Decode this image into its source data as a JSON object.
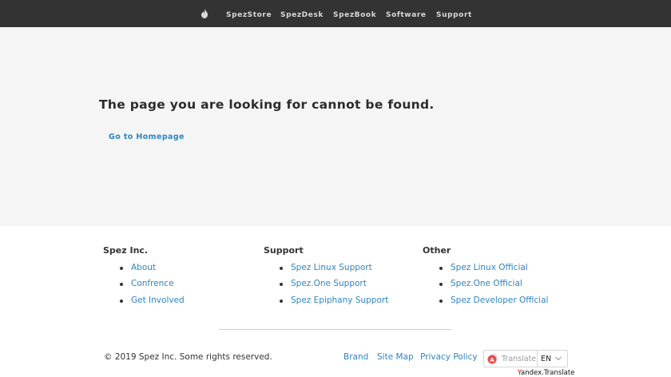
{
  "nav": {
    "logo_icon": "spez-flame-logo-icon",
    "items": [
      {
        "label": "SpezStore"
      },
      {
        "label": "SpezDesk"
      },
      {
        "label": "SpezBook"
      },
      {
        "label": "Software"
      },
      {
        "label": "Support"
      }
    ]
  },
  "main": {
    "headline": "The page you are looking for cannot be found.",
    "home_link": "Go to Homepage"
  },
  "footer": {
    "columns": [
      {
        "title": "Spez Inc.",
        "links": [
          "About",
          "Confrence",
          "Get Involved"
        ]
      },
      {
        "title": "Support",
        "links": [
          "Spez Linux Support",
          "Spez.One Support",
          "Spez Epiphany Support"
        ]
      },
      {
        "title": "Other",
        "links": [
          "Spez Linux Official",
          "Spez.One Official",
          "Spez Developer Official"
        ]
      }
    ],
    "copyright": "© 2019 Spez Inc. Some rights reserved.",
    "bottom_links": [
      "Brand",
      "Site Map",
      "Privacy Policy"
    ],
    "translate": {
      "icon": "translate-icon",
      "label": "Translate",
      "language": "EN",
      "credit_y": "Y",
      "credit_rest": "andex.Translate"
    }
  },
  "colors": {
    "nav_bg": "#333333",
    "nav_text": "#d8d8d8",
    "main_bg": "#f5f5f5",
    "link": "#2d85c5",
    "yandex_red": "#e00000"
  }
}
